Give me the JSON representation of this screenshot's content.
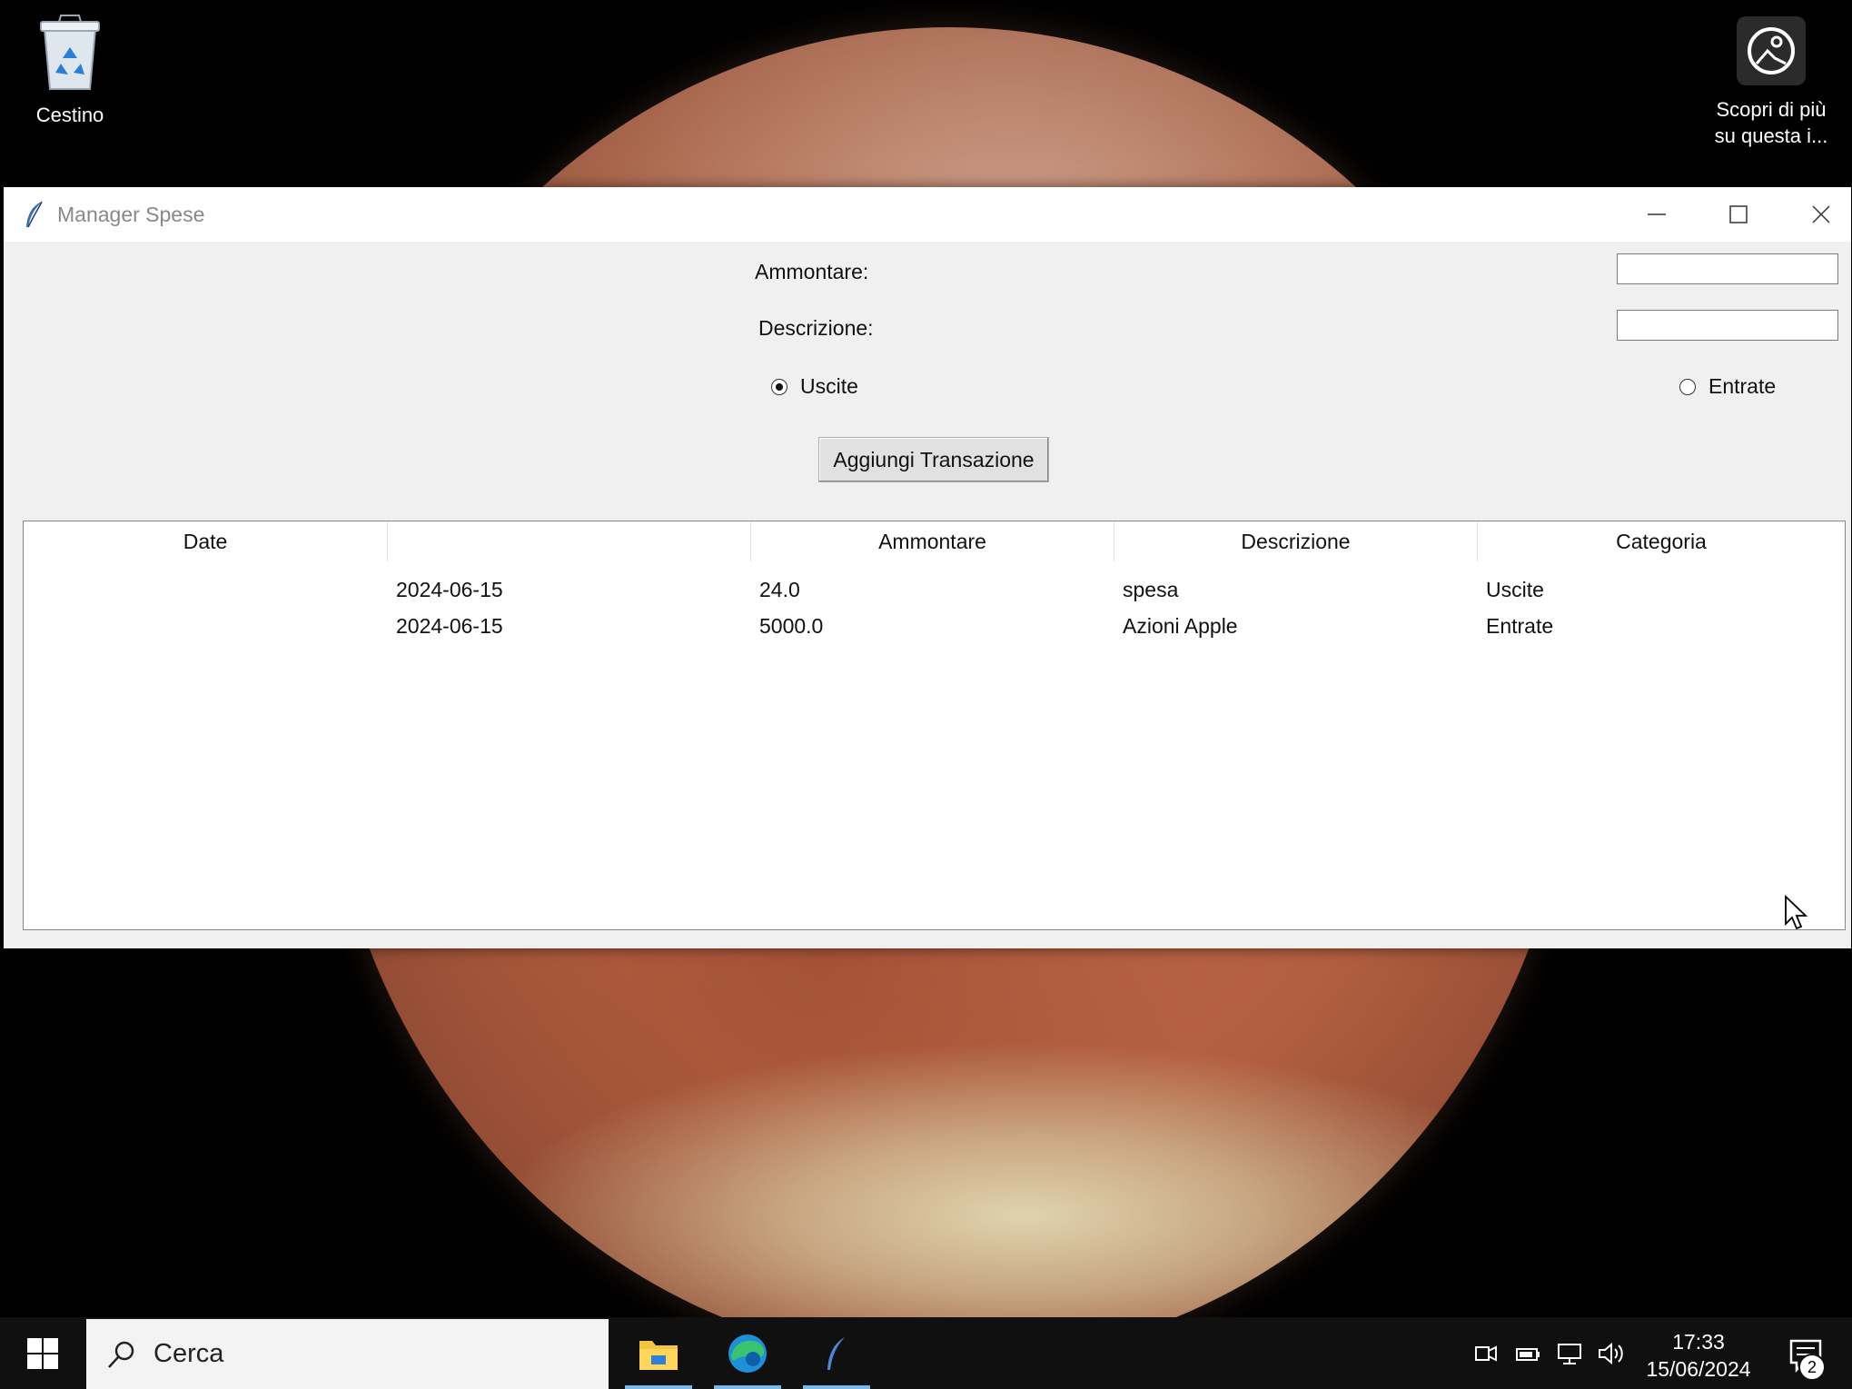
{
  "desktop": {
    "icons": [
      {
        "label": "Cestino",
        "icon": "recycle-bin-icon"
      },
      {
        "label_line1": "Scopri di più",
        "label_line2": "su questa i...",
        "icon": "spotlight-camera-icon"
      }
    ]
  },
  "window": {
    "title": "Manager Spese",
    "controls": [
      "minimize",
      "maximize",
      "close"
    ]
  },
  "form": {
    "amount_label": "Ammontare:",
    "amount_value": "",
    "description_label": "Descrizione:",
    "description_value": "",
    "radio_out_label": "Uscite",
    "radio_in_label": "Entrate",
    "selected_type": "Uscite",
    "add_button_label": "Aggiungi Transazione"
  },
  "table": {
    "columns": [
      "Date",
      "",
      "Ammontare",
      "Descrizione",
      "Categoria"
    ],
    "rows": [
      {
        "col0": "",
        "date": "2024-06-15",
        "amount": "24.0",
        "description": "spesa",
        "category": "Uscite"
      },
      {
        "col0": "",
        "date": "2024-06-15",
        "amount": "5000.0",
        "description": "Azioni Apple",
        "category": "Entrate"
      }
    ]
  },
  "taskbar": {
    "search_placeholder": "Cerca",
    "apps": [
      "file-explorer",
      "edge",
      "python-tk"
    ],
    "time": "17:33",
    "date": "15/06/2024",
    "notification_count": "2"
  },
  "colors": {
    "window_bg": "#f0f0f0",
    "taskbar_bg": "#101010",
    "taskbar_accent": "#76b9ed"
  }
}
